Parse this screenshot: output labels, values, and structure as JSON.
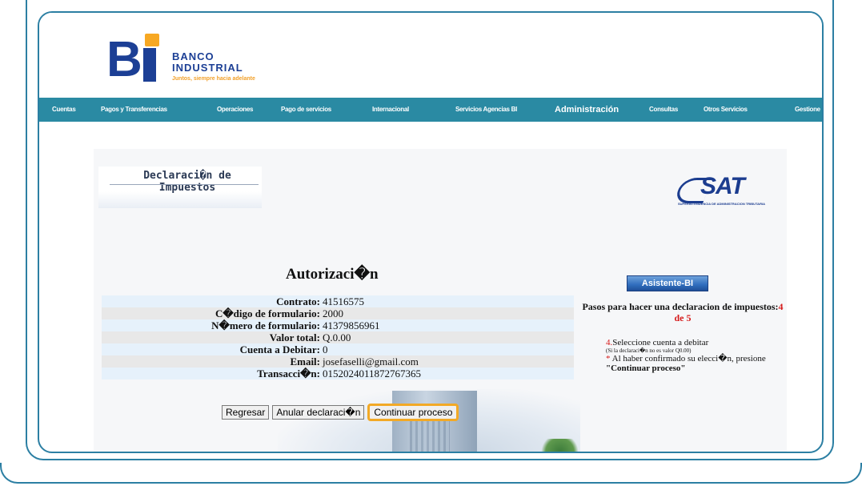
{
  "header": {
    "brand_line1": "BANCO",
    "brand_line2": "INDUSTRIAL",
    "slogan": "Juntos, siempre hacia adelante"
  },
  "nav": {
    "items": [
      {
        "label": "Cuentas"
      },
      {
        "label": "Pagos y Transferencias"
      },
      {
        "label": "Operaciones"
      },
      {
        "label": "Pago de servicios"
      },
      {
        "label": "Internacional"
      },
      {
        "label": "Servicios Agencias BI"
      },
      {
        "label": "Administración"
      },
      {
        "label": "Consultas"
      },
      {
        "label": "Otros Servicios"
      },
      {
        "label": "Gestione"
      }
    ]
  },
  "declaracion": {
    "title_line1": "Declaraci�n de",
    "title_line2": "Impuestos"
  },
  "sat": {
    "logo_text": "SAT",
    "logo_subtitle": "SUPERINTENDENCIA DE ADMINISTRACION TRIBUTARIA"
  },
  "autorizacion": {
    "title": "Autorizaci�n",
    "rows": [
      {
        "label": "Contrato:",
        "value": "41516575"
      },
      {
        "label": "C�digo de formulario:",
        "value": "2000"
      },
      {
        "label": "N�mero de formulario:",
        "value": "41379856961"
      },
      {
        "label": "Valor total:",
        "value": "Q.0.00"
      },
      {
        "label": "Cuenta a Debitar:",
        "value": "0"
      },
      {
        "label": "Email:",
        "value": "josefaselli@gmail.com"
      },
      {
        "label": "Transacci�n:",
        "value": "0152024011872767365"
      }
    ]
  },
  "buttons": {
    "regresar": "Regresar",
    "anular": "Anular declaraci�n",
    "continuar": "Continuar proceso"
  },
  "asistente": {
    "button": "Asistente-BI",
    "pasos_text": "Pasos para hacer una declaracion de impuestos:",
    "pasos_step": "4 de 5",
    "step_num": "4.",
    "step_text": "Seleccione cuenta a debitar",
    "step_note": "(Si la declaraci�n no es valor Q0.00)",
    "star": "*",
    "confirm_text": " Al haber confirmado su elecci�n, presione",
    "confirm_bold": "\"Continuar proceso\""
  },
  "colors": {
    "nav_bg": "#2a8aa3",
    "frame": "#2c7fa3",
    "brand_blue": "#1c3f95",
    "brand_orange": "#f7a823",
    "highlight": "#f2a926",
    "step_red": "#d61b1b"
  }
}
